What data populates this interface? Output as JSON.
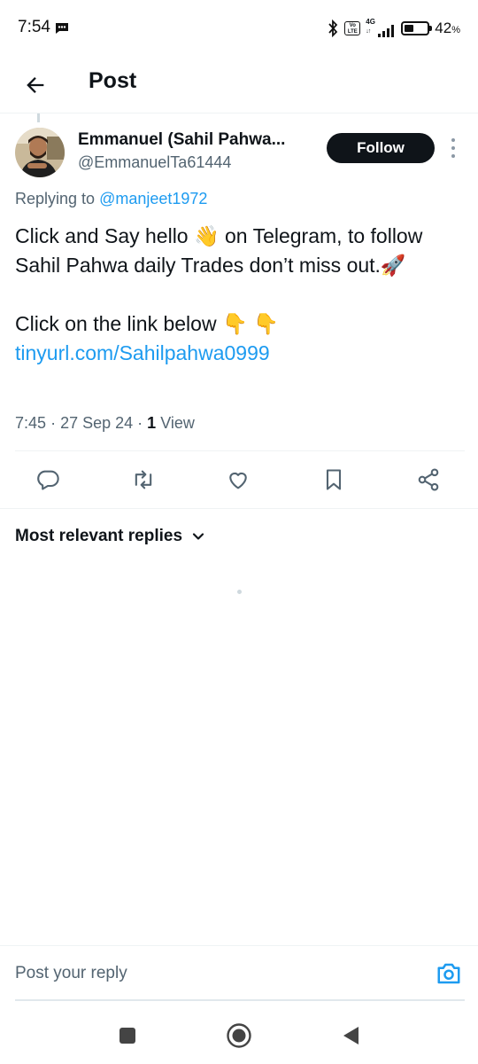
{
  "status_bar": {
    "time": "7:54",
    "network_type": "4G",
    "volte_label": "Vo\nLTE",
    "battery_percent_number": "42",
    "battery_percent_sign": "%",
    "battery_level": 0.42
  },
  "app_bar": {
    "title": "Post"
  },
  "post": {
    "author_name": "Emmanuel (Sahil Pahwa...",
    "author_handle": "@EmmanuelTa61444",
    "follow_label": "Follow",
    "replying_prefix": "Replying to",
    "replying_handle": "@manjeet1972",
    "body_line1": "Click and Say hello 👋 on Telegram, to follow Sahil Pahwa daily Trades don’t miss out.🚀",
    "body_line2": "Click on the link below 👇 👇",
    "link": "tinyurl.com/Sahilpahwa0999",
    "time": "7:45",
    "date": "27 Sep 24",
    "view_count": "1",
    "view_label": "View"
  },
  "replies": {
    "sort_label": "Most relevant replies"
  },
  "composer": {
    "placeholder": "Post your reply"
  },
  "colors": {
    "accent": "#1d9bf0",
    "text": "#0f1419",
    "secondary": "#536471"
  },
  "icons": [
    "back-arrow-icon",
    "more-vertical-icon",
    "reply-icon",
    "repost-icon",
    "like-icon",
    "bookmark-icon",
    "share-icon",
    "chevron-down-icon",
    "camera-icon",
    "nav-recents-icon",
    "nav-home-icon",
    "nav-back-icon"
  ]
}
